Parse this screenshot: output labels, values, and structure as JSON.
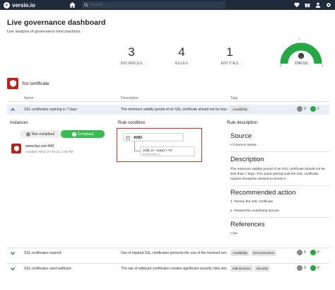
{
  "app": {
    "logo_mark": "v",
    "logo_text": "versio.io",
    "search_placeholder": "Search"
  },
  "header": {
    "title": "Live governance dashboard",
    "subtitle": "Live analysis of governance best practices."
  },
  "stats": [
    {
      "value": "3",
      "label": "INSTANCES"
    },
    {
      "value": "4",
      "label": "RULES"
    },
    {
      "value": "1",
      "label": "ENTITIES"
    }
  ],
  "status_gauge": {
    "label": "STATUS",
    "min": "0",
    "max": "1",
    "max_top": "1",
    "fill_fraction": 1.0,
    "color": "#27a745"
  },
  "section": {
    "title": "Ssl certificate"
  },
  "table": {
    "headers": {
      "name": "Name",
      "description": "Description",
      "tags": "Tags"
    },
    "rows": [
      {
        "name": "SSL certificates expiring in 7 days",
        "description": "The minimum validity period of an SSL certificate should not be less than 7 days.",
        "tags": [
          "Availability"
        ],
        "grey_count": "0",
        "green_count": "1"
      },
      {
        "name": "SSL certificates expired",
        "description": "Use of expired SSL certificates prevents the use of the involved service.",
        "tags": [
          "Availability",
          "Deconstruction"
        ],
        "grey_count": "0",
        "green_count": "0"
      },
      {
        "name": "SSL certificates used wildcard",
        "description": "The use of wildcard certificates creates significant security risks since the",
        "tags": [
          "Maintenance",
          "Security"
        ],
        "grey_count": "0",
        "green_count": "0"
      }
    ]
  },
  "expanded": {
    "instances_heading": "Instances",
    "noncompliant_label": "Non-compliant",
    "noncompliant_count": "0",
    "compliant_label": "Compliant",
    "compliant_count": "1",
    "instance_host": "www.faz.net:443",
    "instance_date": "Created: Wed, 27-09-23, 4:34 PM",
    "condition_heading": "Rule condition",
    "and_label": "AND",
    "condition_expr": "valid_to - now() > 7d",
    "condition_field": "$.data.valid_to",
    "rule_desc_heading": "Rule description",
    "source_title": "Source",
    "source_item": "Common sense.",
    "description_title": "Description",
    "description_text": "The minimum validity period of an SSL certificate should not be less than 7 days. The action period until the SSL certificate expires should be sensed to renew it.",
    "recommended_title": "Recommended action",
    "recommended_1": "1. Renew the SSL certificate.",
    "recommended_2": "2. Restart the underlying service.",
    "references_title": "References",
    "references_item": "n/a"
  },
  "colors": {
    "topbar": "#1f2b3a",
    "accent_green": "#27a745",
    "brand_red": "#b3261e",
    "highlight_border": "#d32f2f",
    "expanded_row": "#e9eef7"
  }
}
